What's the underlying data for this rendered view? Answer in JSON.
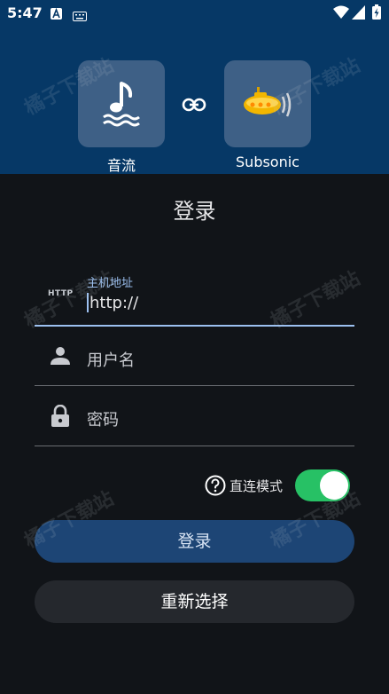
{
  "status_bar": {
    "time": "5:47",
    "icons": [
      "a-notification-icon",
      "keyboard-icon",
      "wifi-icon",
      "signal-icon",
      "battery-charging-icon"
    ]
  },
  "header": {
    "apps": [
      {
        "label": "音流",
        "icon": "music-note-wave-icon"
      },
      {
        "label": "Subsonic",
        "icon": "subsonic-submarine-icon"
      }
    ],
    "link_icon": "link-icon",
    "colors": {
      "background": "#063866",
      "tile": "#3e6086"
    }
  },
  "login": {
    "title": "登录",
    "host": {
      "label": "主机地址",
      "prefix_badge": "HTTP",
      "value": "http://"
    },
    "username": {
      "placeholder": "用户名",
      "icon": "person-icon"
    },
    "password": {
      "placeholder": "密码",
      "icon": "lock-icon"
    },
    "direct_mode": {
      "label": "直连模式",
      "enabled": true,
      "icon": "help-circle-icon"
    },
    "login_button": "登录",
    "reselect_button": "重新选择"
  },
  "watermark": "橘子下载站",
  "colors": {
    "accent": "#9cc0f0",
    "toggle_on": "#27c165",
    "page_background": "#111418"
  }
}
